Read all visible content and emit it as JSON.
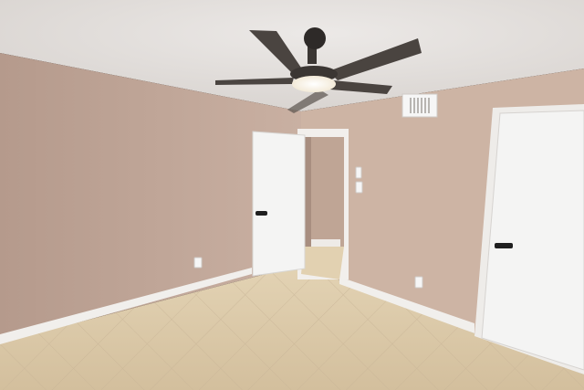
{
  "scene": {
    "subject": "empty-bedroom",
    "colors": {
      "ceiling": "#e6e2df",
      "wall_left": "#c4aa9c",
      "wall_back": "#cfb7a8",
      "wall_right": "#c7ac9a",
      "floor": "#d9c7a8",
      "trim": "#f4f2ef",
      "door": "#f3f3f2",
      "door_handle": "#1f1f1f",
      "fan_blade": "#4a4440",
      "fan_light": "#fbf6ea",
      "vent": "#f6f6f6"
    },
    "icons": [
      "ceiling-fan-icon",
      "air-vent-icon",
      "light-switch-icon",
      "outlet-icon",
      "door-handle-icon"
    ]
  }
}
